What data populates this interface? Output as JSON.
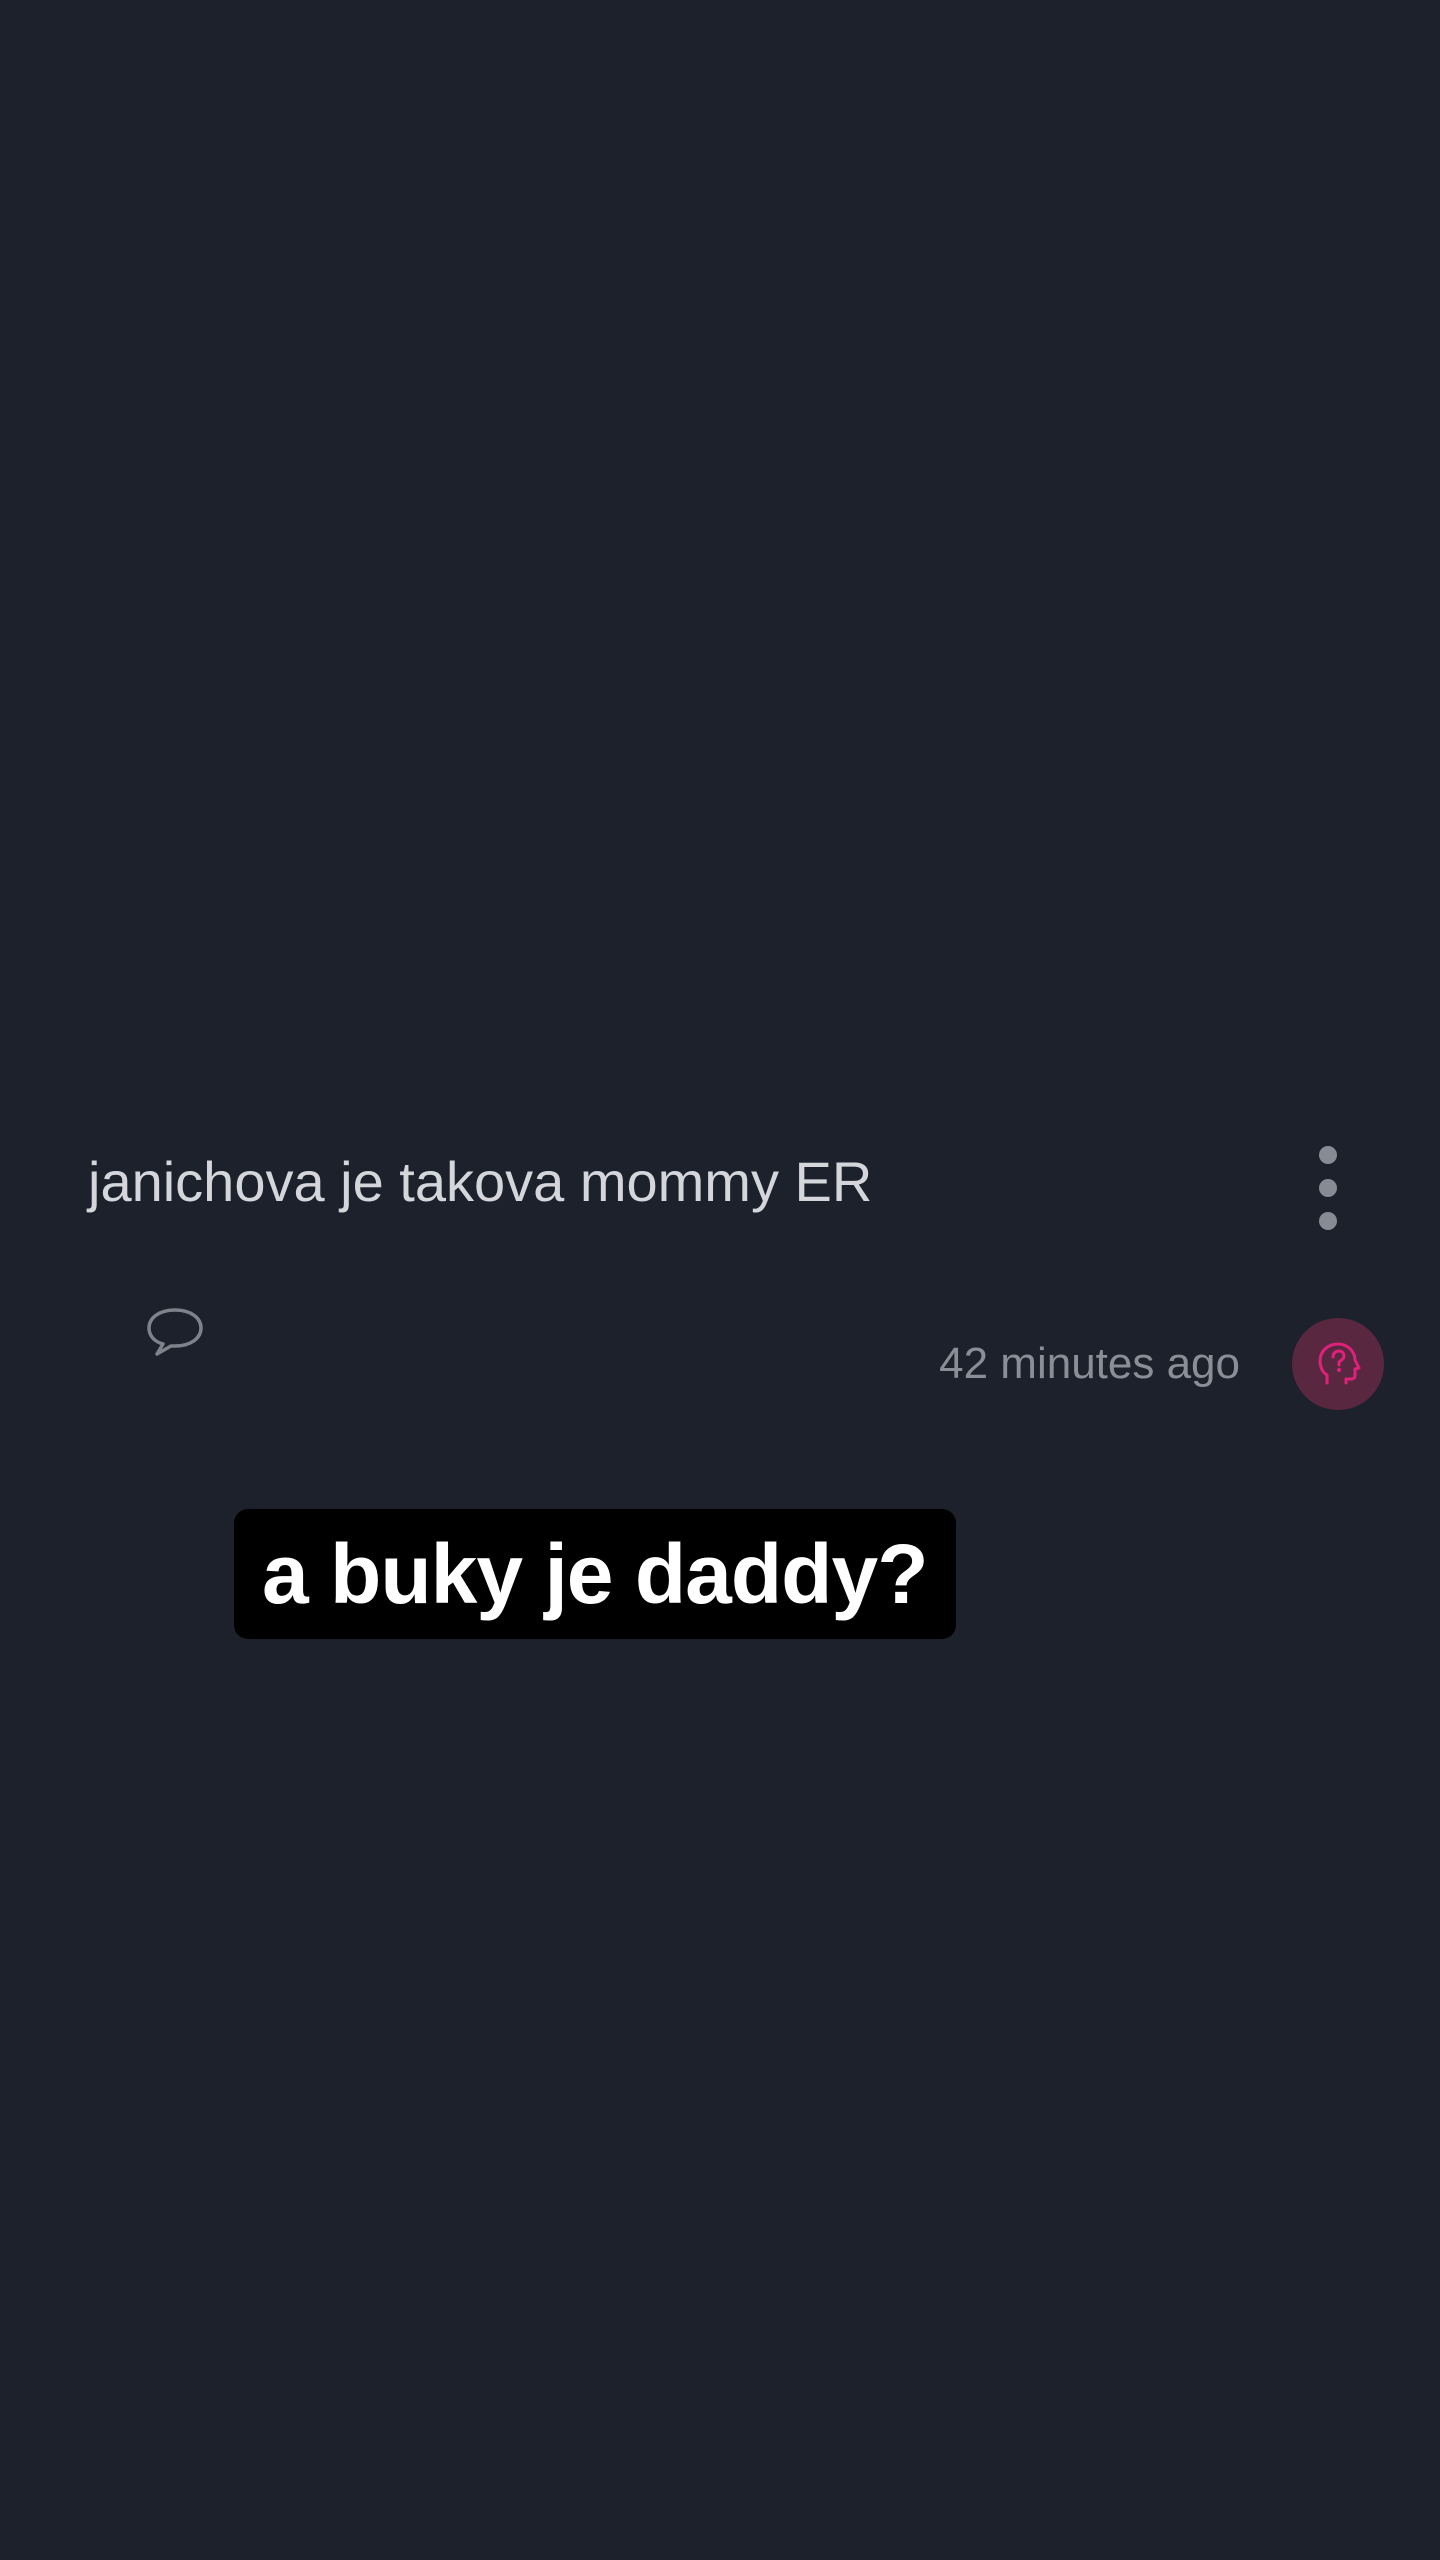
{
  "post": {
    "text": "janichova je takova mommy ER",
    "timestamp": "42 minutes ago"
  },
  "caption": {
    "text": "a buky je daddy?"
  },
  "icons": {
    "more": "more-vertical-icon",
    "comment": "comment-bubble-icon",
    "avatar": "anonymous-question-head-icon"
  },
  "colors": {
    "background": "#1c212b",
    "accent": "#e0217a",
    "avatar_bg": "#5a2740",
    "text_primary": "#d4d6dc",
    "text_secondary": "#8a8e96"
  }
}
